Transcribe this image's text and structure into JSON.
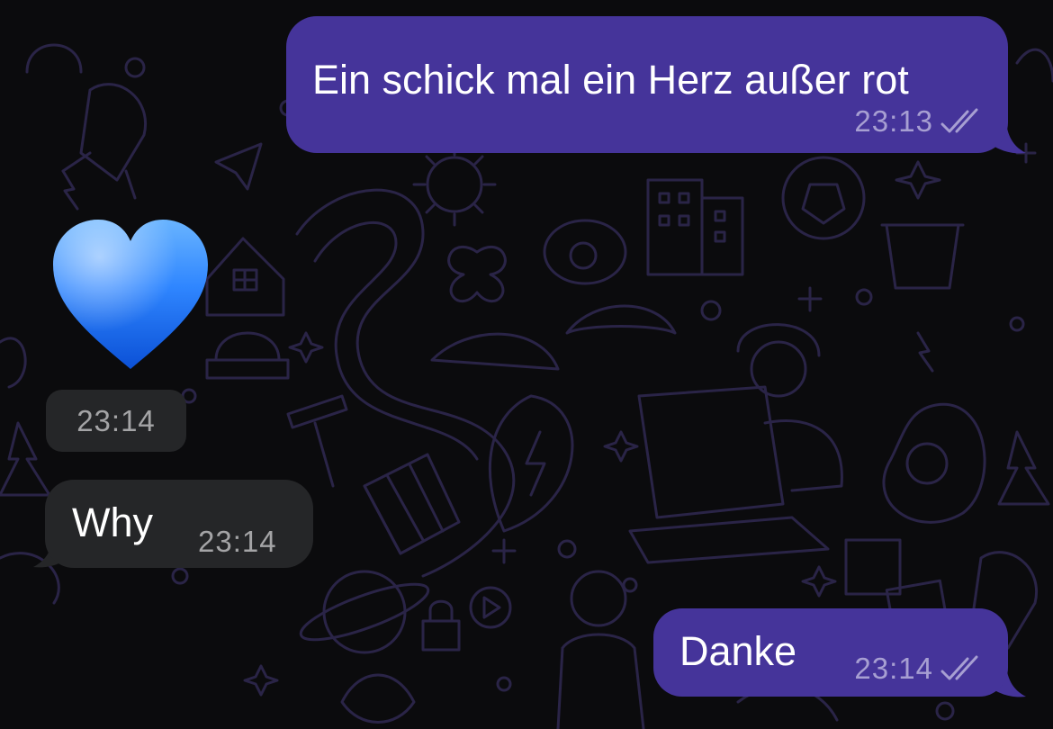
{
  "theme": {
    "background": "#0b0b0d",
    "pattern_color": "#2a2447",
    "outgoing_bubble": "#45349a",
    "incoming_bubble": "#252628",
    "outgoing_time_color": "#a79fd2",
    "incoming_time_color": "#a4a4a6"
  },
  "messages": [
    {
      "direction": "outgoing",
      "text": "Ein schick mal ein Herz außer rot",
      "time": "23:13",
      "status_icon": "double-check-icon"
    },
    {
      "direction": "incoming",
      "emoji": "blue-heart-icon",
      "time": "23:14"
    },
    {
      "direction": "incoming",
      "text": "Why",
      "time": "23:14"
    },
    {
      "direction": "outgoing",
      "text": "Danke",
      "time": "23:14",
      "status_icon": "double-check-icon"
    }
  ]
}
